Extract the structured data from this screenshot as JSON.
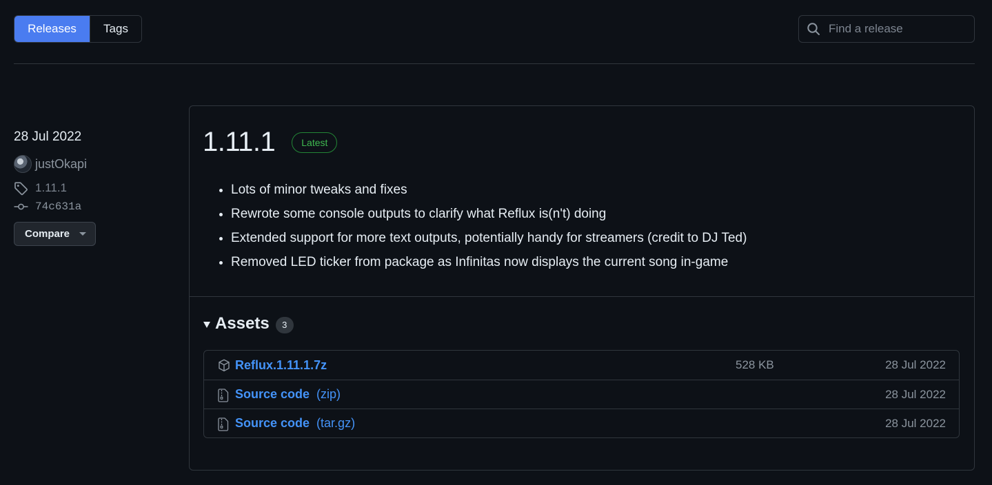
{
  "tabs": {
    "releases": "Releases",
    "tags": "Tags"
  },
  "search": {
    "placeholder": "Find a release"
  },
  "release_meta": {
    "date": "28 Jul 2022",
    "author": "justOkapi",
    "tag": "1.11.1",
    "commit": "74c631a",
    "compare_label": "Compare"
  },
  "release": {
    "version": "1.11.1",
    "badge": "Latest",
    "notes": [
      "Lots of minor tweaks and fixes",
      "Rewrote some console outputs to clarify what Reflux is(n't) doing",
      "Extended support for more text outputs, potentially handy for streamers (credit to DJ Ted)",
      "Removed LED ticker from package as Infinitas now displays the current song in-game"
    ]
  },
  "assets": {
    "title": "Assets",
    "count": "3",
    "items": [
      {
        "name": "Reflux.1.11.1.7z",
        "ext": "",
        "size": "528 KB",
        "date": "28 Jul 2022",
        "icon": "package-icon"
      },
      {
        "name": "Source code",
        "ext": "(zip)",
        "size": "",
        "date": "28 Jul 2022",
        "icon": "file-zip-icon"
      },
      {
        "name": "Source code",
        "ext": "(tar.gz)",
        "size": "",
        "date": "28 Jul 2022",
        "icon": "file-zip-icon"
      }
    ]
  },
  "colors": {
    "accent": "#4a7cf0",
    "link": "#4493f8",
    "latest": "#3fb950",
    "background": "#0d1117",
    "border": "#30363d"
  }
}
